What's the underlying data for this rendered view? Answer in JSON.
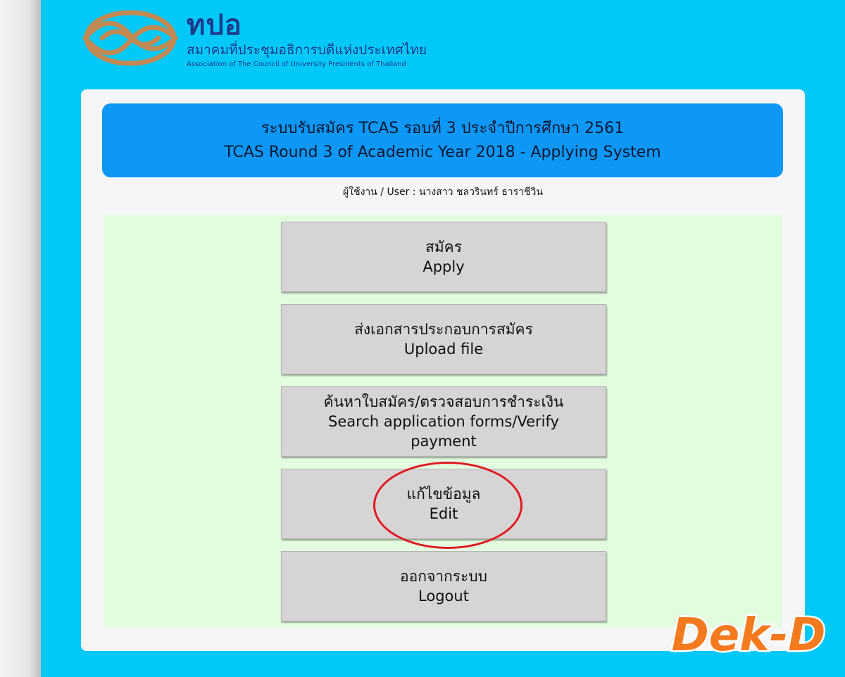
{
  "header": {
    "logo_abbr": "ทปอ",
    "org_name_th": "สมาคมที่ประชุมอธิการบดีแห่งประเทศไทย",
    "org_name_en": "Association of The Council of University Presidents of Thailand"
  },
  "banner": {
    "title_th": "ระบบรับสมัคร TCAS รอบที่ 3 ประจำปีการศึกษา 2561",
    "title_en": "TCAS Round 3 of Academic Year 2018 - Applying System"
  },
  "user": {
    "text": "ผู้ใช้งาน / User : นางสาว ชลวรินทร์ ธาราชีวิน"
  },
  "menu": {
    "apply": {
      "th": "สมัคร",
      "en": "Apply"
    },
    "upload": {
      "th": "ส่งเอกสารประกอบการสมัคร",
      "en": "Upload file"
    },
    "search": {
      "th": "ค้นหาใบสมัคร/ตรวจสอบการชำระเงิน",
      "en": "Search application forms/Verify payment"
    },
    "edit": {
      "th": "แก้ไขข้อมูล",
      "en": "Edit"
    },
    "logout": {
      "th": "ออกจากระบบ",
      "en": "Logout"
    }
  },
  "watermark": {
    "text": "Dek-D"
  },
  "colors": {
    "page_bg": "#00c8f8",
    "banner": "#0d98f7",
    "menu_area": "#e3fce0",
    "button": "#d6d4d4",
    "logo_blue": "#1f3a8a",
    "logo_gold": "#c28a52",
    "highlight": "#e01a22",
    "watermark_orange": "#f47a1f"
  }
}
